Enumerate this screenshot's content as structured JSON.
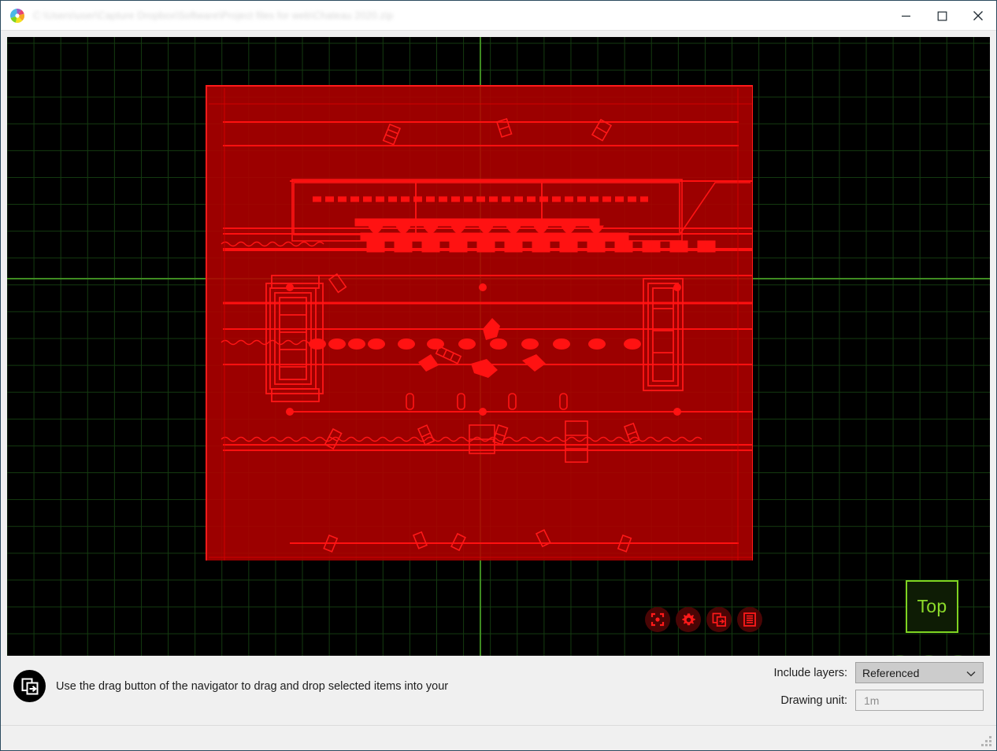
{
  "window": {
    "title": "C:\\Users\\user\\Capture Dropbox\\Software\\Project files for web\\Chateau 2020.zip",
    "app_icon": "pinwheel-logo-icon",
    "controls": {
      "minimize": "minimize-icon",
      "maximize": "maximize-icon",
      "close": "close-icon"
    }
  },
  "viewport": {
    "background_color": "#000000",
    "grid_color": "#143b10",
    "axis_color": "#3e8b21",
    "overlay_fill": "#b20000",
    "overlay_stroke": "#ff1a1a",
    "view_cube_label": "Top",
    "view_cube_color": "#7ed321",
    "tools": [
      {
        "name": "fit-to-view",
        "icon": "expand-icon"
      },
      {
        "name": "settings",
        "icon": "gear-icon"
      },
      {
        "name": "drag-drop",
        "icon": "drag-drop-icon"
      },
      {
        "name": "layers-list",
        "icon": "list-icon"
      }
    ],
    "nav_buttons": [
      {
        "name": "orbit",
        "icon": "orbit-arrow-icon"
      },
      {
        "name": "pan",
        "icon": "pan-arrow-icon"
      },
      {
        "name": "menu",
        "icon": "hamburger-icon"
      }
    ]
  },
  "bottom": {
    "hint_icon": "drag-drop-icon",
    "hint_text": "Use the drag button of the navigator to drag and drop selected items into your",
    "include_layers_label": "Include layers:",
    "include_layers_value": "Referenced",
    "include_layers_options": [
      "Referenced"
    ],
    "drawing_unit_label": "Drawing unit:",
    "drawing_unit_value": "",
    "drawing_unit_placeholder": "1m"
  }
}
